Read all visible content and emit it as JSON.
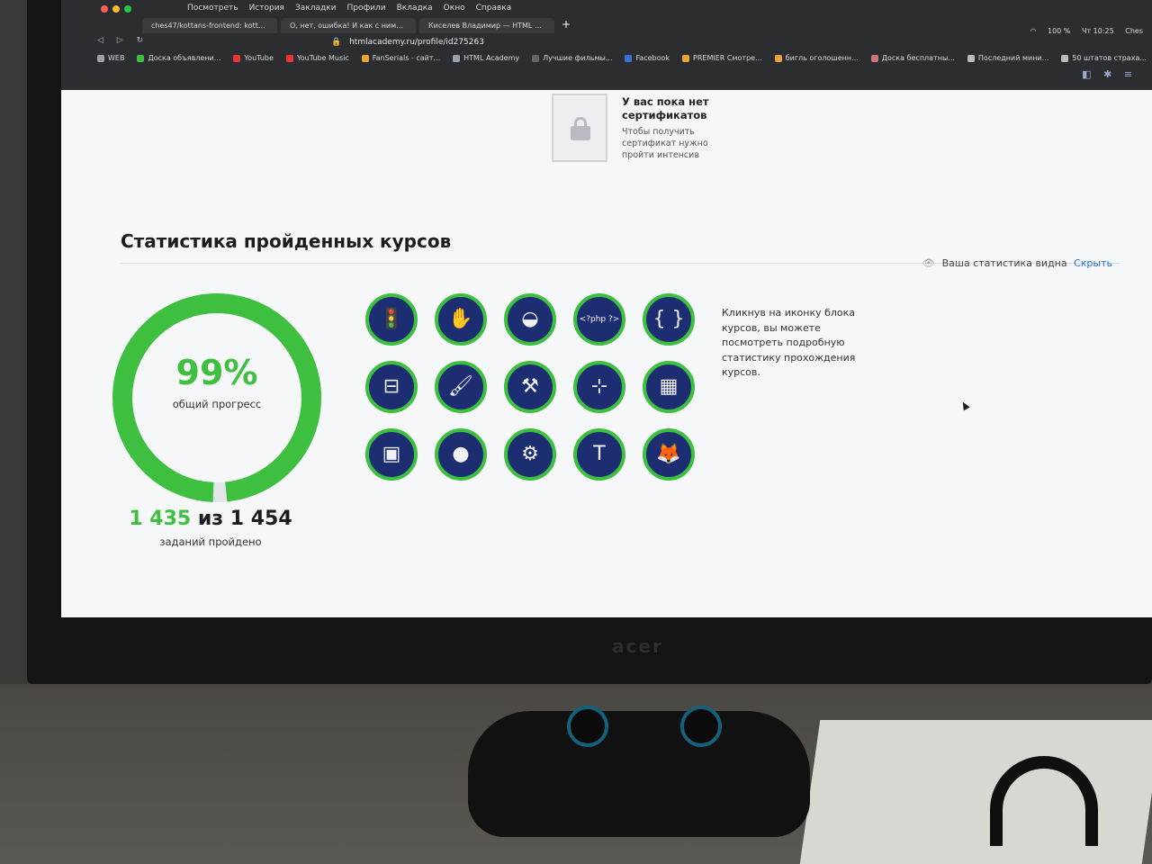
{
  "menubar": {
    "items": [
      "Посмотреть",
      "История",
      "Закладки",
      "Профили",
      "Вкладка",
      "Окно",
      "Справка"
    ],
    "status": {
      "battery": "100 %",
      "time": "Чт 10:25",
      "user": "Ches"
    }
  },
  "tabs": [
    {
      "title": "ches47/kottans-frontend: kotta"
    },
    {
      "title": "О, нет, ошибка! И как с ними"
    },
    {
      "title": "Киселев Владимир — HTML A"
    }
  ],
  "address": {
    "url": "htmlacademy.ru/profile/id275263"
  },
  "bookmarks": [
    {
      "label": "WEB",
      "color": "#9aa3ad"
    },
    {
      "label": "Доска объявлени...",
      "color": "#3fbf3f"
    },
    {
      "label": "YouTube",
      "color": "#e33"
    },
    {
      "label": "YouTube Music",
      "color": "#e33"
    },
    {
      "label": "FanSerials - сайт...",
      "color": "#e8a33a"
    },
    {
      "label": "HTML Academy",
      "color": "#9aa3ad"
    },
    {
      "label": "Лучшие фильмы...",
      "color": "#666"
    },
    {
      "label": "Facebook",
      "color": "#3b6fd6"
    },
    {
      "label": "PREMIER Смотре...",
      "color": "#e8a33a"
    },
    {
      "label": "бигль оголошенн...",
      "color": "#e8a33a"
    },
    {
      "label": "Доска бесплатны...",
      "color": "#c77"
    },
    {
      "label": "Последний мини...",
      "color": "#bbb"
    },
    {
      "label": "50 штатов страха...",
      "color": "#bbb"
    }
  ],
  "certificate": {
    "title": "У вас пока нет сертификатов",
    "text": "Чтобы получить сертификат нужно пройти интенсив"
  },
  "stats": {
    "title": "Статистика пройденных курсов",
    "visibility_text": "Ваша статистика видна",
    "hide_label": "Скрыть",
    "progress_percent": "99%",
    "progress_value": 0.99,
    "progress_label": "общий прогресс",
    "done": "1 435",
    "of": "из",
    "total": "1 454",
    "count_label": "заданий пройдено",
    "hint": "Кликнув на иконку блока курсов, вы можете посмотреть подробную статистику прохождения курсов.",
    "accent_color": "#3fbf3f",
    "badge_color": "#1d2d72"
  },
  "badges": [
    {
      "name": "traffic-light-icon",
      "glyph": "🚦"
    },
    {
      "name": "hand-icon",
      "glyph": "✋"
    },
    {
      "name": "spinning-top-icon",
      "glyph": "◒"
    },
    {
      "name": "php-clapperboard-icon",
      "glyph": "<?php ?>"
    },
    {
      "name": "curly-braces-icon",
      "glyph": "{ }"
    },
    {
      "name": "football-field-icon",
      "glyph": "⊟"
    },
    {
      "name": "paint-brush-icon",
      "glyph": "🖌"
    },
    {
      "name": "anvil-icon",
      "glyph": "⚒"
    },
    {
      "name": "vector-path-icon",
      "glyph": "⊹"
    },
    {
      "name": "rubiks-cube-icon",
      "glyph": "▦"
    },
    {
      "name": "robot-remote-icon",
      "glyph": "▣"
    },
    {
      "name": "planet-icon",
      "glyph": "●"
    },
    {
      "name": "chainsaw-icon",
      "glyph": "⚙"
    },
    {
      "name": "typography-t-icon",
      "glyph": "T"
    },
    {
      "name": "fox-icon",
      "glyph": "🦊"
    }
  ]
}
